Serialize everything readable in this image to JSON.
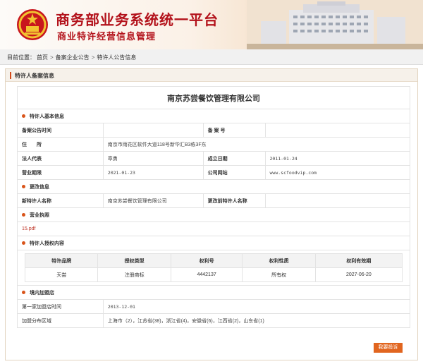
{
  "header": {
    "title_main": "商务部业务系统统一平台",
    "title_sub": "商业特许经营信息管理"
  },
  "breadcrumb": {
    "label": "目前位置：",
    "items": [
      "首页",
      "备案企业公告",
      "特许人公告信息"
    ]
  },
  "panel": {
    "title": "特许人备案信息"
  },
  "company_name": "南京苏尝餐饮管理有限公司",
  "sections": {
    "basic": "特许人基本信息",
    "changes": "更改信息",
    "license": "营业执照",
    "authorization": "特许人授权内容",
    "domestic": "境内加盟店"
  },
  "basic_info": {
    "record_time_label": "备案公告时间",
    "record_time_value": "",
    "record_no_label": "备 案 号",
    "record_no_value": "",
    "address_label": "住　　所",
    "address_value": "南京市雨花区软件大道118号新华汇B3栋3F东",
    "legal_rep_label": "法人代表",
    "legal_rep_value": "章勇",
    "established_label": "成立日期",
    "established_value": "2011-01-24",
    "term_label": "营业期限",
    "term_value": "2021-01-23",
    "website_label": "公司网站",
    "website_value": "www.scfoodvip.com"
  },
  "change_info": {
    "new_name_label": "新特许人名称",
    "new_name_value": "南京苏尝餐饮管理有限公司",
    "old_name_label": "更改前特许人名称",
    "old_name_value": ""
  },
  "license": {
    "file": "15.pdf"
  },
  "authorization": {
    "headers": [
      "特许品牌",
      "授权类型",
      "权利号",
      "权利性质",
      "权利有效期"
    ],
    "rows": [
      [
        "天尝",
        "注册商标",
        "4442137",
        "所有权",
        "2027-06-20"
      ]
    ]
  },
  "domestic": {
    "first_time_label": "第一家加盟店时间",
    "first_time_value": "2013-12-01",
    "distribution_label": "加盟分布区域",
    "distribution_value": "上海市（2），江苏省(38)，浙江省(4)，安徽省(6)，江西省(2)，山东省(1)"
  },
  "actions": {
    "complain": "我要投诉"
  },
  "colors": {
    "brand_red": "#b3121b",
    "accent_orange": "#e1651f"
  }
}
